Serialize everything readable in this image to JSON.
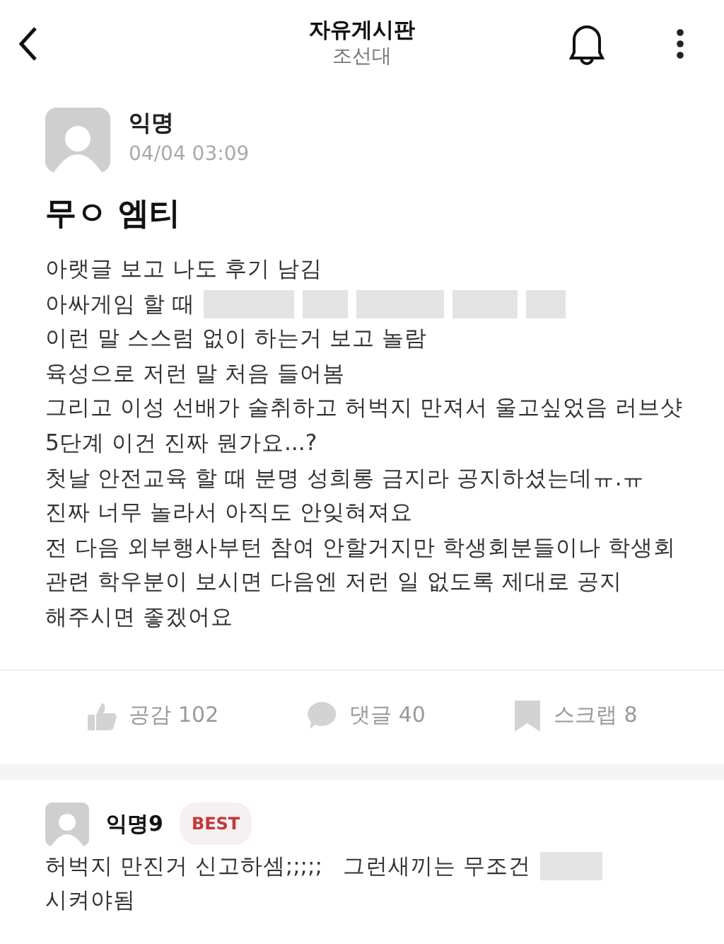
{
  "header": {
    "title": "자유게시판",
    "subtitle": "조선대"
  },
  "post": {
    "author": "익명",
    "time": "04/04 03:09",
    "title": "무ㅇ 엠티",
    "lines": [
      {
        "kind": "plain",
        "text": "아랫글 보고 나도 후기 남김"
      },
      {
        "kind": "redacted",
        "text": "아싸게임 할 때"
      },
      {
        "kind": "plain",
        "text": "이런 말 스스럼 없이 하는거 보고 놀람"
      },
      {
        "kind": "plain",
        "text": "육성으로 저런 말 처음 들어봄"
      },
      {
        "kind": "plain",
        "text": "그리고 이성 선배가 술취하고 허벅지 만져서 울고싶었음 러브샷"
      },
      {
        "kind": "plain",
        "text": "5단계 이건 진짜 뭔가요...?"
      },
      {
        "kind": "plain",
        "text": "첫날 안전교육 할 때 분명 성희롱 금지라 공지하셨는데ㅠ.ㅠ"
      },
      {
        "kind": "plain",
        "text": "진짜 너무 놀라서 아직도 안잊혀져요"
      },
      {
        "kind": "plain",
        "text": "전 다음 외부행사부턴 참여 안할거지만 학생회분들이나 학생회"
      },
      {
        "kind": "plain",
        "text": "관련 학우분이 보시면 다음엔 저런 일 없도록 제대로 공지"
      },
      {
        "kind": "plain",
        "text": "해주시면 좋겠어요"
      }
    ]
  },
  "actions": [
    {
      "kind": "like",
      "label": "공감 102"
    },
    {
      "kind": "comment",
      "label": "댓글 40"
    },
    {
      "kind": "scrap",
      "label": "스크랩 8"
    }
  ],
  "comment": {
    "author": "익명9",
    "badge": "BEST",
    "lines": [
      {
        "kind": "redacted",
        "text": "허벅지 만진거 신고하셈;;;;;   그런새끼는 무조건"
      },
      {
        "kind": "plain",
        "text": "시켜야됨"
      }
    ]
  }
}
